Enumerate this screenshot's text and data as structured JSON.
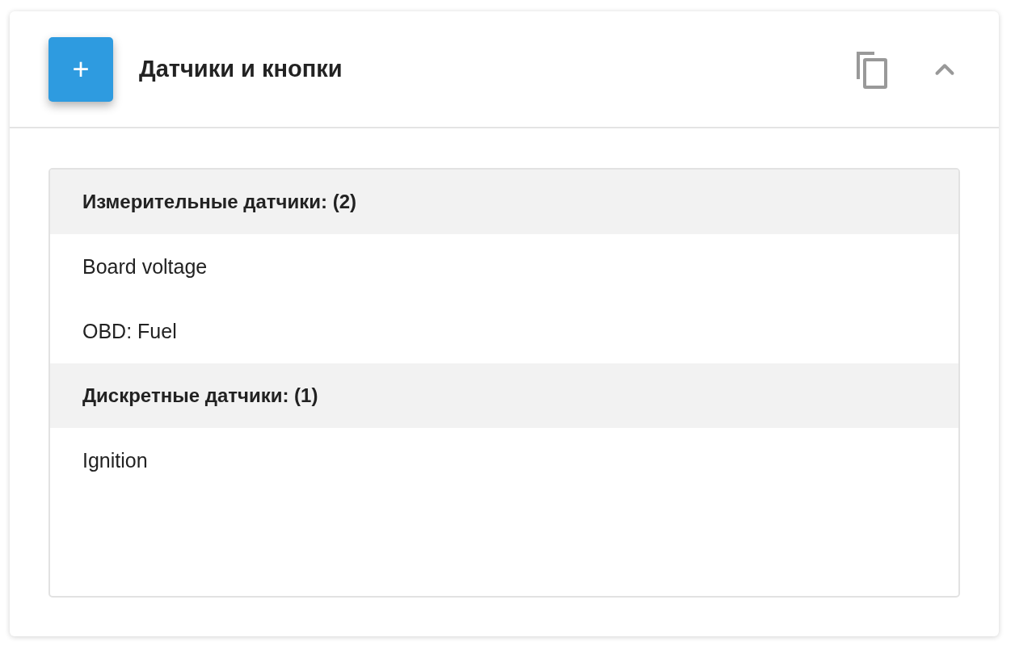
{
  "card": {
    "add_button": "+",
    "title": "Датчики и кнопки",
    "expanded": true,
    "groups": [
      {
        "title": "Измерительные датчики: (2)",
        "items": [
          "Board voltage",
          "OBD: Fuel"
        ]
      },
      {
        "title": "Дискретные датчики: (1)",
        "items": [
          "Ignition"
        ]
      }
    ]
  }
}
